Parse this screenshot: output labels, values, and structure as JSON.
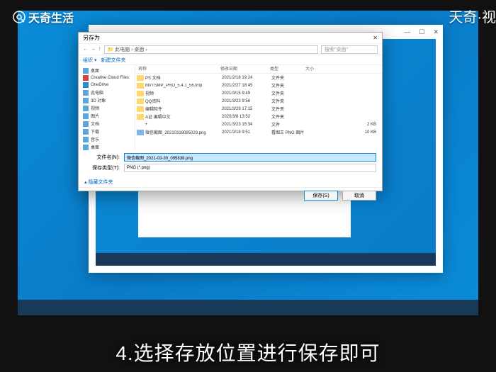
{
  "brand": {
    "topleft": "天奇生活",
    "topright": "天奇·视"
  },
  "caption": "4.选择存放位置进行保存即可",
  "dialog": {
    "title": "另存为",
    "breadcrumb": "📁 此电脑 › 桌面 ›",
    "search_placeholder": "搜索\"桌面\"",
    "organize": "组织 ▾",
    "newfolder": "新建文件夹",
    "headers": {
      "name": "名称",
      "date": "修改日期",
      "type": "类型",
      "size": "大小"
    },
    "sidebar": [
      {
        "label": "桌面",
        "color": "#5aa7e0"
      },
      {
        "label": "Creative Cloud Files",
        "color": "#d64545"
      },
      {
        "label": "OneDrive",
        "color": "#2a8acb"
      },
      {
        "label": "此电脑",
        "color": "#5aa7e0"
      },
      {
        "label": "3D 对象",
        "color": "#5aa7e0"
      },
      {
        "label": "视频",
        "color": "#5aa7e0"
      },
      {
        "label": "图片",
        "color": "#5aa7e0"
      },
      {
        "label": "文档",
        "color": "#5aa7e0"
      },
      {
        "label": "下载",
        "color": "#5aa7e0"
      },
      {
        "label": "音乐",
        "color": "#5aa7e0"
      },
      {
        "label": "桌面",
        "color": "#5aa7e0"
      }
    ],
    "files": [
      {
        "name": "PS 文档",
        "date": "2021/2/18 19:24",
        "type": "文件夹",
        "size": "",
        "icon": "folder"
      },
      {
        "name": "MVTSMP_PRO_5.4.1_56.tmp",
        "date": "2021/2/27 18:45",
        "type": "文件夹",
        "size": "",
        "icon": "folder"
      },
      {
        "name": "视频",
        "date": "2021/3/15 9:49",
        "type": "文件夹",
        "size": "",
        "icon": "folder"
      },
      {
        "name": "QQ资料",
        "date": "2021/3/23 9:56",
        "type": "文件夹",
        "size": "",
        "icon": "folder"
      },
      {
        "name": "编辑软件",
        "date": "2021/3/29 17:15",
        "type": "文件夹",
        "size": "",
        "icon": "folder"
      },
      {
        "name": "A证  编辑中文",
        "date": "2020/3/8 13:52",
        "type": "文件夹",
        "size": "",
        "icon": "folder"
      },
      {
        "name": "+",
        "date": "2021/3/23 15:34",
        "type": "文件",
        "size": "2 KB",
        "icon": "file"
      },
      {
        "name": "微信截图_20210318095029.png",
        "date": "2021/3/18 9:51",
        "type": "看图王 PNG 图片",
        "size": "10 KB",
        "icon": "png"
      }
    ],
    "filename_label": "文件名(N):",
    "filename_value": "微信截图_2021-03-30_095838.png",
    "filetype_label": "保存类型(T):",
    "filetype_value": "PNG (*.png)",
    "hide_folders": "▴ 隐藏文件夹",
    "save_btn": "保存(S)",
    "cancel_btn": "取消"
  },
  "snip_controls": {
    "min": "—",
    "max": "☐",
    "close": "✕"
  }
}
